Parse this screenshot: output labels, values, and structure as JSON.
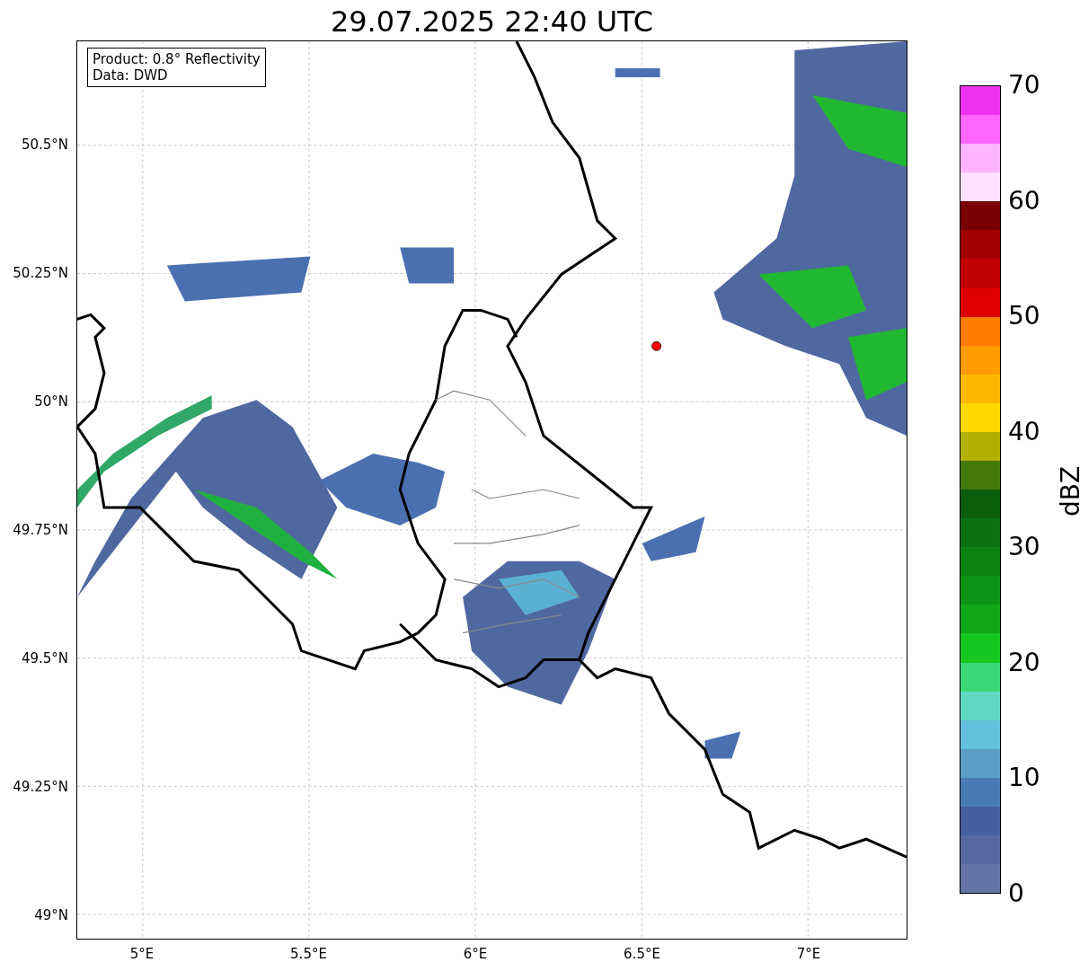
{
  "title": "29.07.2025 22:40 UTC",
  "info_box": {
    "lines": [
      "Product: 0.8° Reflectivity",
      "Data: DWD"
    ]
  },
  "map": {
    "lat_ticks": [
      "50.5°N",
      "50.25°N",
      "50°N",
      "49.75°N",
      "49.5°N",
      "49.25°N",
      "49°N"
    ],
    "lon_ticks": [
      "5°E",
      "5.5°E",
      "6°E",
      "6.5°E",
      "7°E"
    ]
  },
  "colorbar": {
    "label": "dBZ",
    "ticks": [
      "70",
      "60",
      "50",
      "40",
      "30",
      "20",
      "10",
      "0"
    ],
    "segments": [
      {
        "color": "#ee33ee"
      },
      {
        "color": "#ff66ff"
      },
      {
        "color": "#ffb4ff"
      },
      {
        "color": "#ffe0ff"
      },
      {
        "color": "#780000"
      },
      {
        "color": "#a00000"
      },
      {
        "color": "#c00000"
      },
      {
        "color": "#e00000"
      },
      {
        "color": "#ff7c00"
      },
      {
        "color": "#ff9c00"
      },
      {
        "color": "#ffb800"
      },
      {
        "color": "#ffd800"
      },
      {
        "color": "#b0b000"
      },
      {
        "color": "#447a0c"
      },
      {
        "color": "#0a5e0c"
      },
      {
        "color": "#0a7010"
      },
      {
        "color": "#0c8212"
      },
      {
        "color": "#0e9414"
      },
      {
        "color": "#10a818"
      },
      {
        "color": "#14c820"
      },
      {
        "color": "#3cd878"
      },
      {
        "color": "#60d8c4"
      },
      {
        "color": "#64c0dc"
      },
      {
        "color": "#5a9ec8"
      },
      {
        "color": "#4a7ab4"
      },
      {
        "color": "#4560a0"
      },
      {
        "color": "#5868a0"
      },
      {
        "color": "#6474a4"
      }
    ]
  }
}
